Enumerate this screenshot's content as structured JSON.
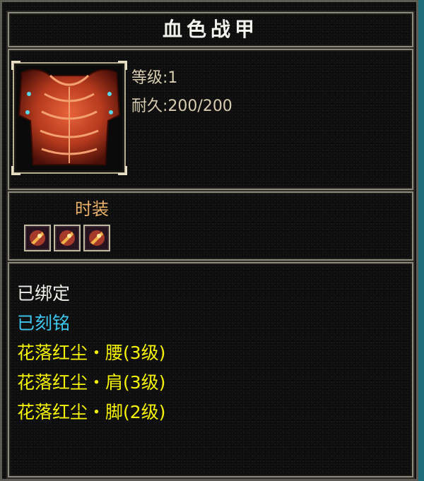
{
  "item": {
    "name": "血色战甲",
    "level_text": "等级:1",
    "durability_text": "耐久:200/200",
    "icon": "armor-chestplate-icon"
  },
  "fashion": {
    "label": "时装",
    "slots": [
      "flame-gem-icon",
      "flame-gem-icon",
      "flame-gem-icon"
    ]
  },
  "attributes": [
    {
      "text": "已绑定",
      "color": "#f0f0ea"
    },
    {
      "text": "已刻铭",
      "color": "#3fc6ef"
    },
    {
      "text": "花落红尘・腰(3级)",
      "color": "#f5f20a"
    },
    {
      "text": "花落红尘・肩(3级)",
      "color": "#f5f20a"
    },
    {
      "text": "花落红尘・脚(2级)",
      "color": "#f5f20a"
    }
  ]
}
